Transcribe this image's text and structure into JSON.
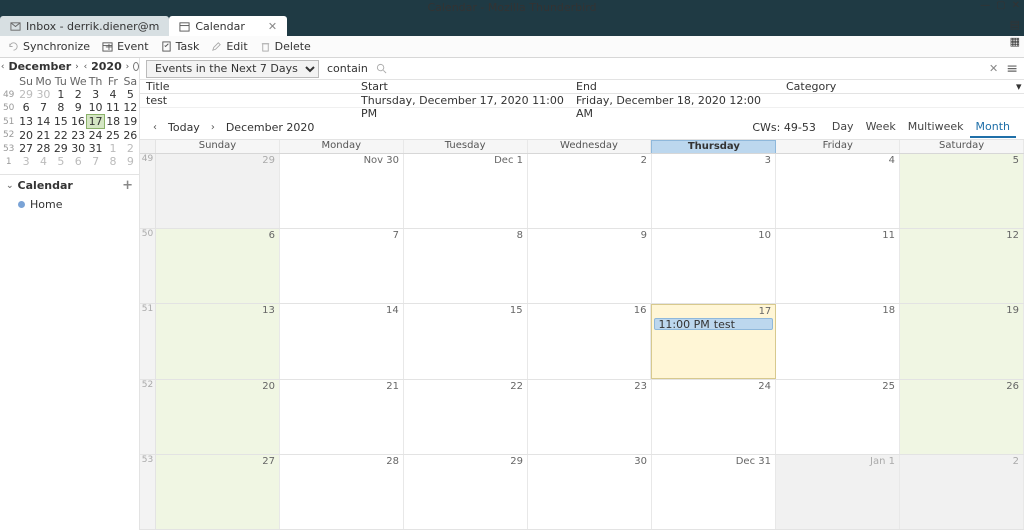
{
  "window": {
    "title": "Calendar - Mozilla Thunderbird"
  },
  "tabs": {
    "inbox": "Inbox - derrik.diener@m",
    "calendar": "Calendar"
  },
  "toolbar": {
    "sync": "Synchronize",
    "event": "Event",
    "task": "Task",
    "edit": "Edit",
    "delete": "Delete"
  },
  "minical": {
    "month": "December",
    "year": "2020",
    "dow": [
      "Su",
      "Mo",
      "Tu",
      "We",
      "Th",
      "Fr",
      "Sa"
    ],
    "weeks": [
      {
        "wk": "49",
        "d": [
          {
            "n": "29",
            "o": true
          },
          {
            "n": "30",
            "o": true
          },
          {
            "n": "1"
          },
          {
            "n": "2"
          },
          {
            "n": "3"
          },
          {
            "n": "4"
          },
          {
            "n": "5"
          }
        ]
      },
      {
        "wk": "50",
        "d": [
          {
            "n": "6"
          },
          {
            "n": "7"
          },
          {
            "n": "8"
          },
          {
            "n": "9"
          },
          {
            "n": "10"
          },
          {
            "n": "11"
          },
          {
            "n": "12"
          }
        ]
      },
      {
        "wk": "51",
        "d": [
          {
            "n": "13"
          },
          {
            "n": "14"
          },
          {
            "n": "15"
          },
          {
            "n": "16"
          },
          {
            "n": "17",
            "t": true
          },
          {
            "n": "18"
          },
          {
            "n": "19"
          }
        ]
      },
      {
        "wk": "52",
        "d": [
          {
            "n": "20"
          },
          {
            "n": "21"
          },
          {
            "n": "22"
          },
          {
            "n": "23"
          },
          {
            "n": "24"
          },
          {
            "n": "25"
          },
          {
            "n": "26"
          }
        ]
      },
      {
        "wk": "53",
        "d": [
          {
            "n": "27"
          },
          {
            "n": "28"
          },
          {
            "n": "29"
          },
          {
            "n": "30"
          },
          {
            "n": "31"
          },
          {
            "n": "1",
            "o": true
          },
          {
            "n": "2",
            "o": true
          }
        ]
      },
      {
        "wk": "1",
        "d": [
          {
            "n": "3",
            "o": true
          },
          {
            "n": "4",
            "o": true
          },
          {
            "n": "5",
            "o": true
          },
          {
            "n": "6",
            "o": true
          },
          {
            "n": "7",
            "o": true
          },
          {
            "n": "8",
            "o": true
          },
          {
            "n": "9",
            "o": true
          }
        ]
      }
    ]
  },
  "sidebar": {
    "section": "Calendar",
    "items": [
      "Home"
    ]
  },
  "filter": {
    "dropdown": "Events in the Next 7 Days",
    "label": "contain"
  },
  "list": {
    "headers": {
      "title": "Title",
      "start": "Start",
      "end": "End",
      "category": "Category"
    },
    "rows": [
      {
        "title": "test",
        "start": "Thursday, December 17, 2020 11:00 PM",
        "end": "Friday, December 18, 2020 12:00 AM",
        "category": ""
      }
    ]
  },
  "viewbar": {
    "today": "Today",
    "month_label": "December 2020",
    "cws": "CWs: 49-53",
    "views": {
      "day": "Day",
      "week": "Week",
      "multi": "Multiweek",
      "month": "Month"
    }
  },
  "grid": {
    "dow": [
      "Sunday",
      "Monday",
      "Tuesday",
      "Wednesday",
      "Thursday",
      "Friday",
      "Saturday"
    ],
    "today_col": 4,
    "rows": [
      {
        "wk": "49",
        "days": [
          {
            "n": "29",
            "o": true
          },
          {
            "n": "Nov 30"
          },
          {
            "n": "Dec 1"
          },
          {
            "n": "2"
          },
          {
            "n": "3"
          },
          {
            "n": "4"
          },
          {
            "n": "5",
            "w": true
          }
        ]
      },
      {
        "wk": "50",
        "days": [
          {
            "n": "6",
            "w": true
          },
          {
            "n": "7"
          },
          {
            "n": "8"
          },
          {
            "n": "9"
          },
          {
            "n": "10"
          },
          {
            "n": "11"
          },
          {
            "n": "12",
            "w": true
          }
        ]
      },
      {
        "wk": "51",
        "days": [
          {
            "n": "13",
            "w": true
          },
          {
            "n": "14"
          },
          {
            "n": "15"
          },
          {
            "n": "16"
          },
          {
            "n": "17",
            "t": true,
            "ev": {
              "time": "11:00 PM",
              "title": "test"
            }
          },
          {
            "n": "18"
          },
          {
            "n": "19",
            "w": true
          }
        ]
      },
      {
        "wk": "52",
        "days": [
          {
            "n": "20",
            "w": true
          },
          {
            "n": "21"
          },
          {
            "n": "22"
          },
          {
            "n": "23"
          },
          {
            "n": "24"
          },
          {
            "n": "25"
          },
          {
            "n": "26",
            "w": true
          }
        ]
      },
      {
        "wk": "53",
        "days": [
          {
            "n": "27",
            "w": true
          },
          {
            "n": "28"
          },
          {
            "n": "29"
          },
          {
            "n": "30"
          },
          {
            "n": "Dec 31"
          },
          {
            "n": "Jan 1",
            "o": true
          },
          {
            "n": "2",
            "o": true
          }
        ]
      }
    ]
  }
}
